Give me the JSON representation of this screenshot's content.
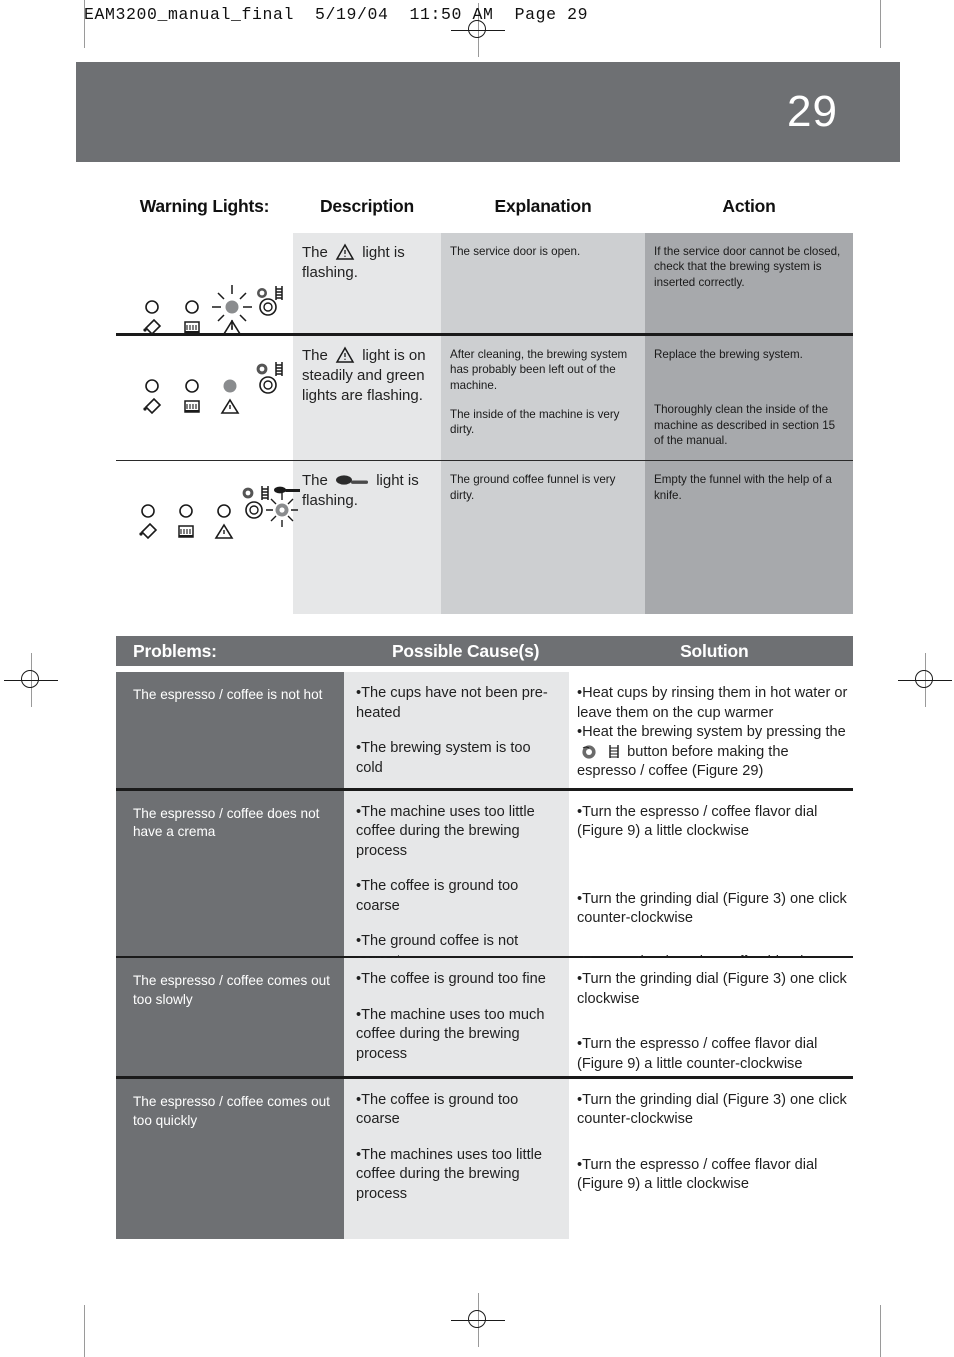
{
  "slug": "EAM3200_manual_final  5/19/04  11:50 AM  Page 29",
  "page_number": "29",
  "colors": {
    "banner": "#6e7073",
    "desc_cell": "#e6e7e8",
    "expl_cell": "#cdcfd1",
    "action_cell": "#a7a9ac",
    "problem_cell": "#6e7073",
    "rule": "#1a1a1a"
  },
  "warning_table": {
    "headers": {
      "lights": "Warning Lights:",
      "description": "Description",
      "explanation": "Explanation",
      "action": "Action"
    },
    "rows": [
      {
        "description_pre": "The",
        "description_icon": "warning-triangle-icon",
        "description_post": "light is flashing.",
        "explanation": [
          "The service door is open."
        ],
        "action": [
          "If the service door cannot be closed, check that the brewing system is inserted correctly."
        ],
        "lamp_states": [
          "off",
          "off",
          "flashing",
          "off",
          "none"
        ]
      },
      {
        "description_pre": "The",
        "description_icon": "warning-triangle-icon",
        "description_post": "light is on steadily and green lights are flashing.",
        "explanation": [
          "After cleaning, the brewing system has probably been left out of the machine.",
          "The inside of the machine is very dirty."
        ],
        "action": [
          "Replace the brewing system.",
          "Thoroughly clean the inside of the machine as described in section 15 of the manual."
        ],
        "lamp_states": [
          "off",
          "off",
          "on",
          "off",
          "none"
        ]
      },
      {
        "description_pre": "The",
        "description_icon": "scoop-icon",
        "description_post": "light is flashing.",
        "explanation": [
          "The ground coffee funnel is very dirty."
        ],
        "action": [
          "Empty the funnel with the help of a knife."
        ],
        "lamp_states": [
          "off",
          "off",
          "off",
          "off",
          "flashing"
        ]
      }
    ]
  },
  "problems_table": {
    "headers": {
      "problems": "Problems:",
      "causes": "Possible Cause(s)",
      "solution": "Solution"
    },
    "rows": [
      {
        "problem": "The espresso / coffee is not hot",
        "causes": [
          "•The cups have not been pre-heated",
          "•The brewing system is too cold"
        ],
        "solutions": [
          "•Heat cups by rinsing them in hot water or leave them on the cup warmer",
          "•Heat the brewing system by pressing the ⟨steam-icon⟩ ⟨cup-icon⟩ button before making the espresso / coffee (Figure 29)"
        ],
        "solution_has_buttons": true,
        "solution_parts": {
          "line2_a": "•Heat the brewing system by pressing",
          "line2_b": "the",
          "line2_c": "button before making the",
          "line2_d": "espresso / coffee (Figure 29)"
        }
      },
      {
        "problem": "The espresso / coffee does not have a crema",
        "causes": [
          "•The machine uses too little coffee during the brewing process",
          "•The coffee is ground too coarse",
          "•The ground coffee is not correct"
        ],
        "solutions": [
          "•Turn the espresso / coffee flavor dial (Figure 9) a little clockwise",
          "•Turn the grinding dial (Figure 3) one click counter-clockwise",
          "•Use another brand or coffee blend"
        ],
        "solution_has_buttons": false
      },
      {
        "problem": "The espresso / coffee comes out too slowly",
        "causes": [
          "•The coffee is ground too fine",
          "•The machine uses too much coffee during the brewing process"
        ],
        "solutions": [
          "•Turn the grinding dial (Figure 3) one click clockwise",
          "•Turn the espresso / coffee flavor dial (Figure 9) a little counter-clockwise"
        ],
        "solution_has_buttons": false
      },
      {
        "problem": "The espresso / coffee comes out too quickly",
        "causes": [
          "•The coffee is ground too coarse",
          "•The machines uses too little coffee during the brewing process"
        ],
        "solutions": [
          "•Turn the grinding dial (Figure 3) one click counter-clockwise",
          "•Turn the espresso / coffee flavor dial (Figure 9) a little clockwise"
        ],
        "solution_has_buttons": false
      }
    ]
  }
}
